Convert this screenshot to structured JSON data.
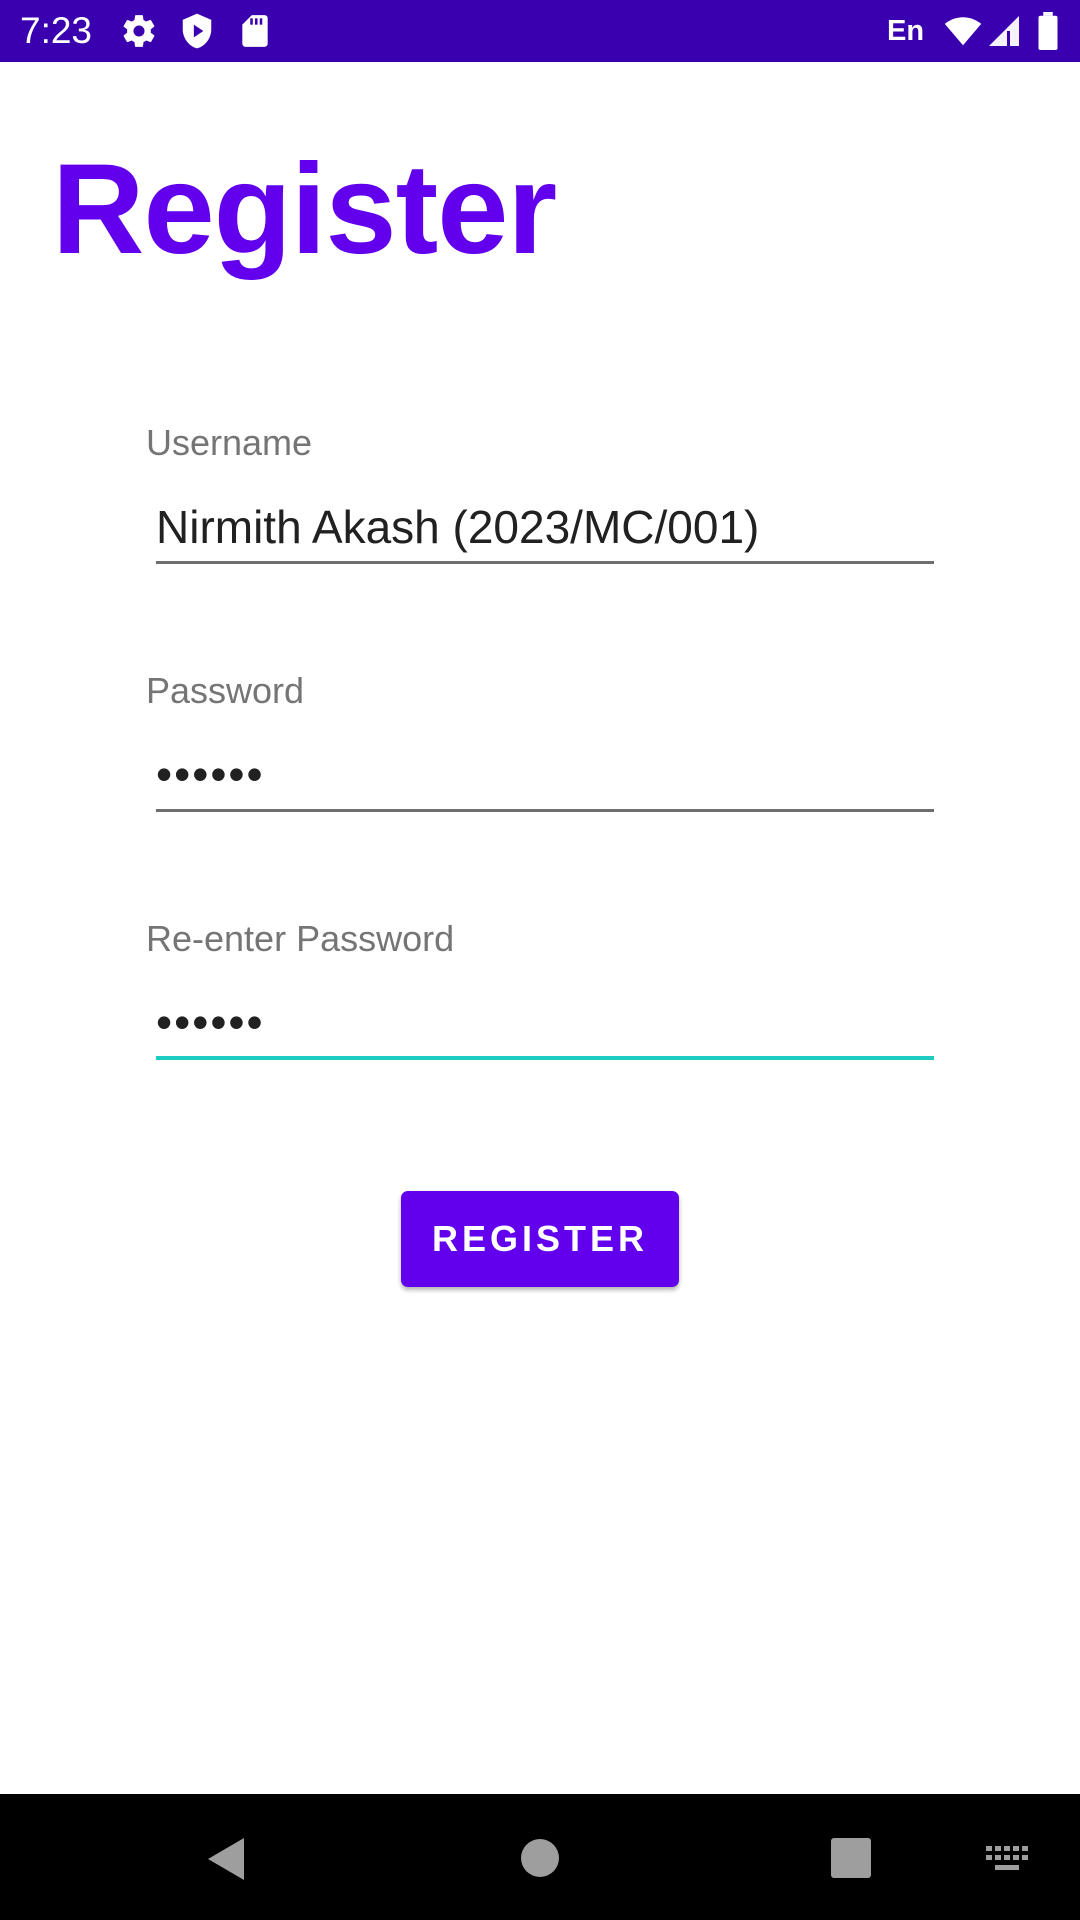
{
  "status_bar": {
    "time": "7:23",
    "language": "En",
    "icons": [
      "gear-icon",
      "shield-play-icon",
      "sd-card-icon",
      "wifi-icon",
      "signal-icon",
      "battery-icon"
    ],
    "background_color": "#3a00b0"
  },
  "page": {
    "title": "Register",
    "accent_color": "#6200ee"
  },
  "form": {
    "username": {
      "label": "Username",
      "value": "Nirmith Akash (2023/MC/001)"
    },
    "password": {
      "label": "Password",
      "masked_value": "••••••"
    },
    "reenter_password": {
      "label": "Re-enter Password",
      "masked_value": "••••••",
      "focused": true,
      "focus_color": "#1ecbc1"
    },
    "register_button": {
      "label": "REGISTER"
    }
  },
  "nav_bar": {
    "icons": [
      "back-icon",
      "home-icon",
      "recents-icon",
      "keyboard-icon"
    ]
  }
}
